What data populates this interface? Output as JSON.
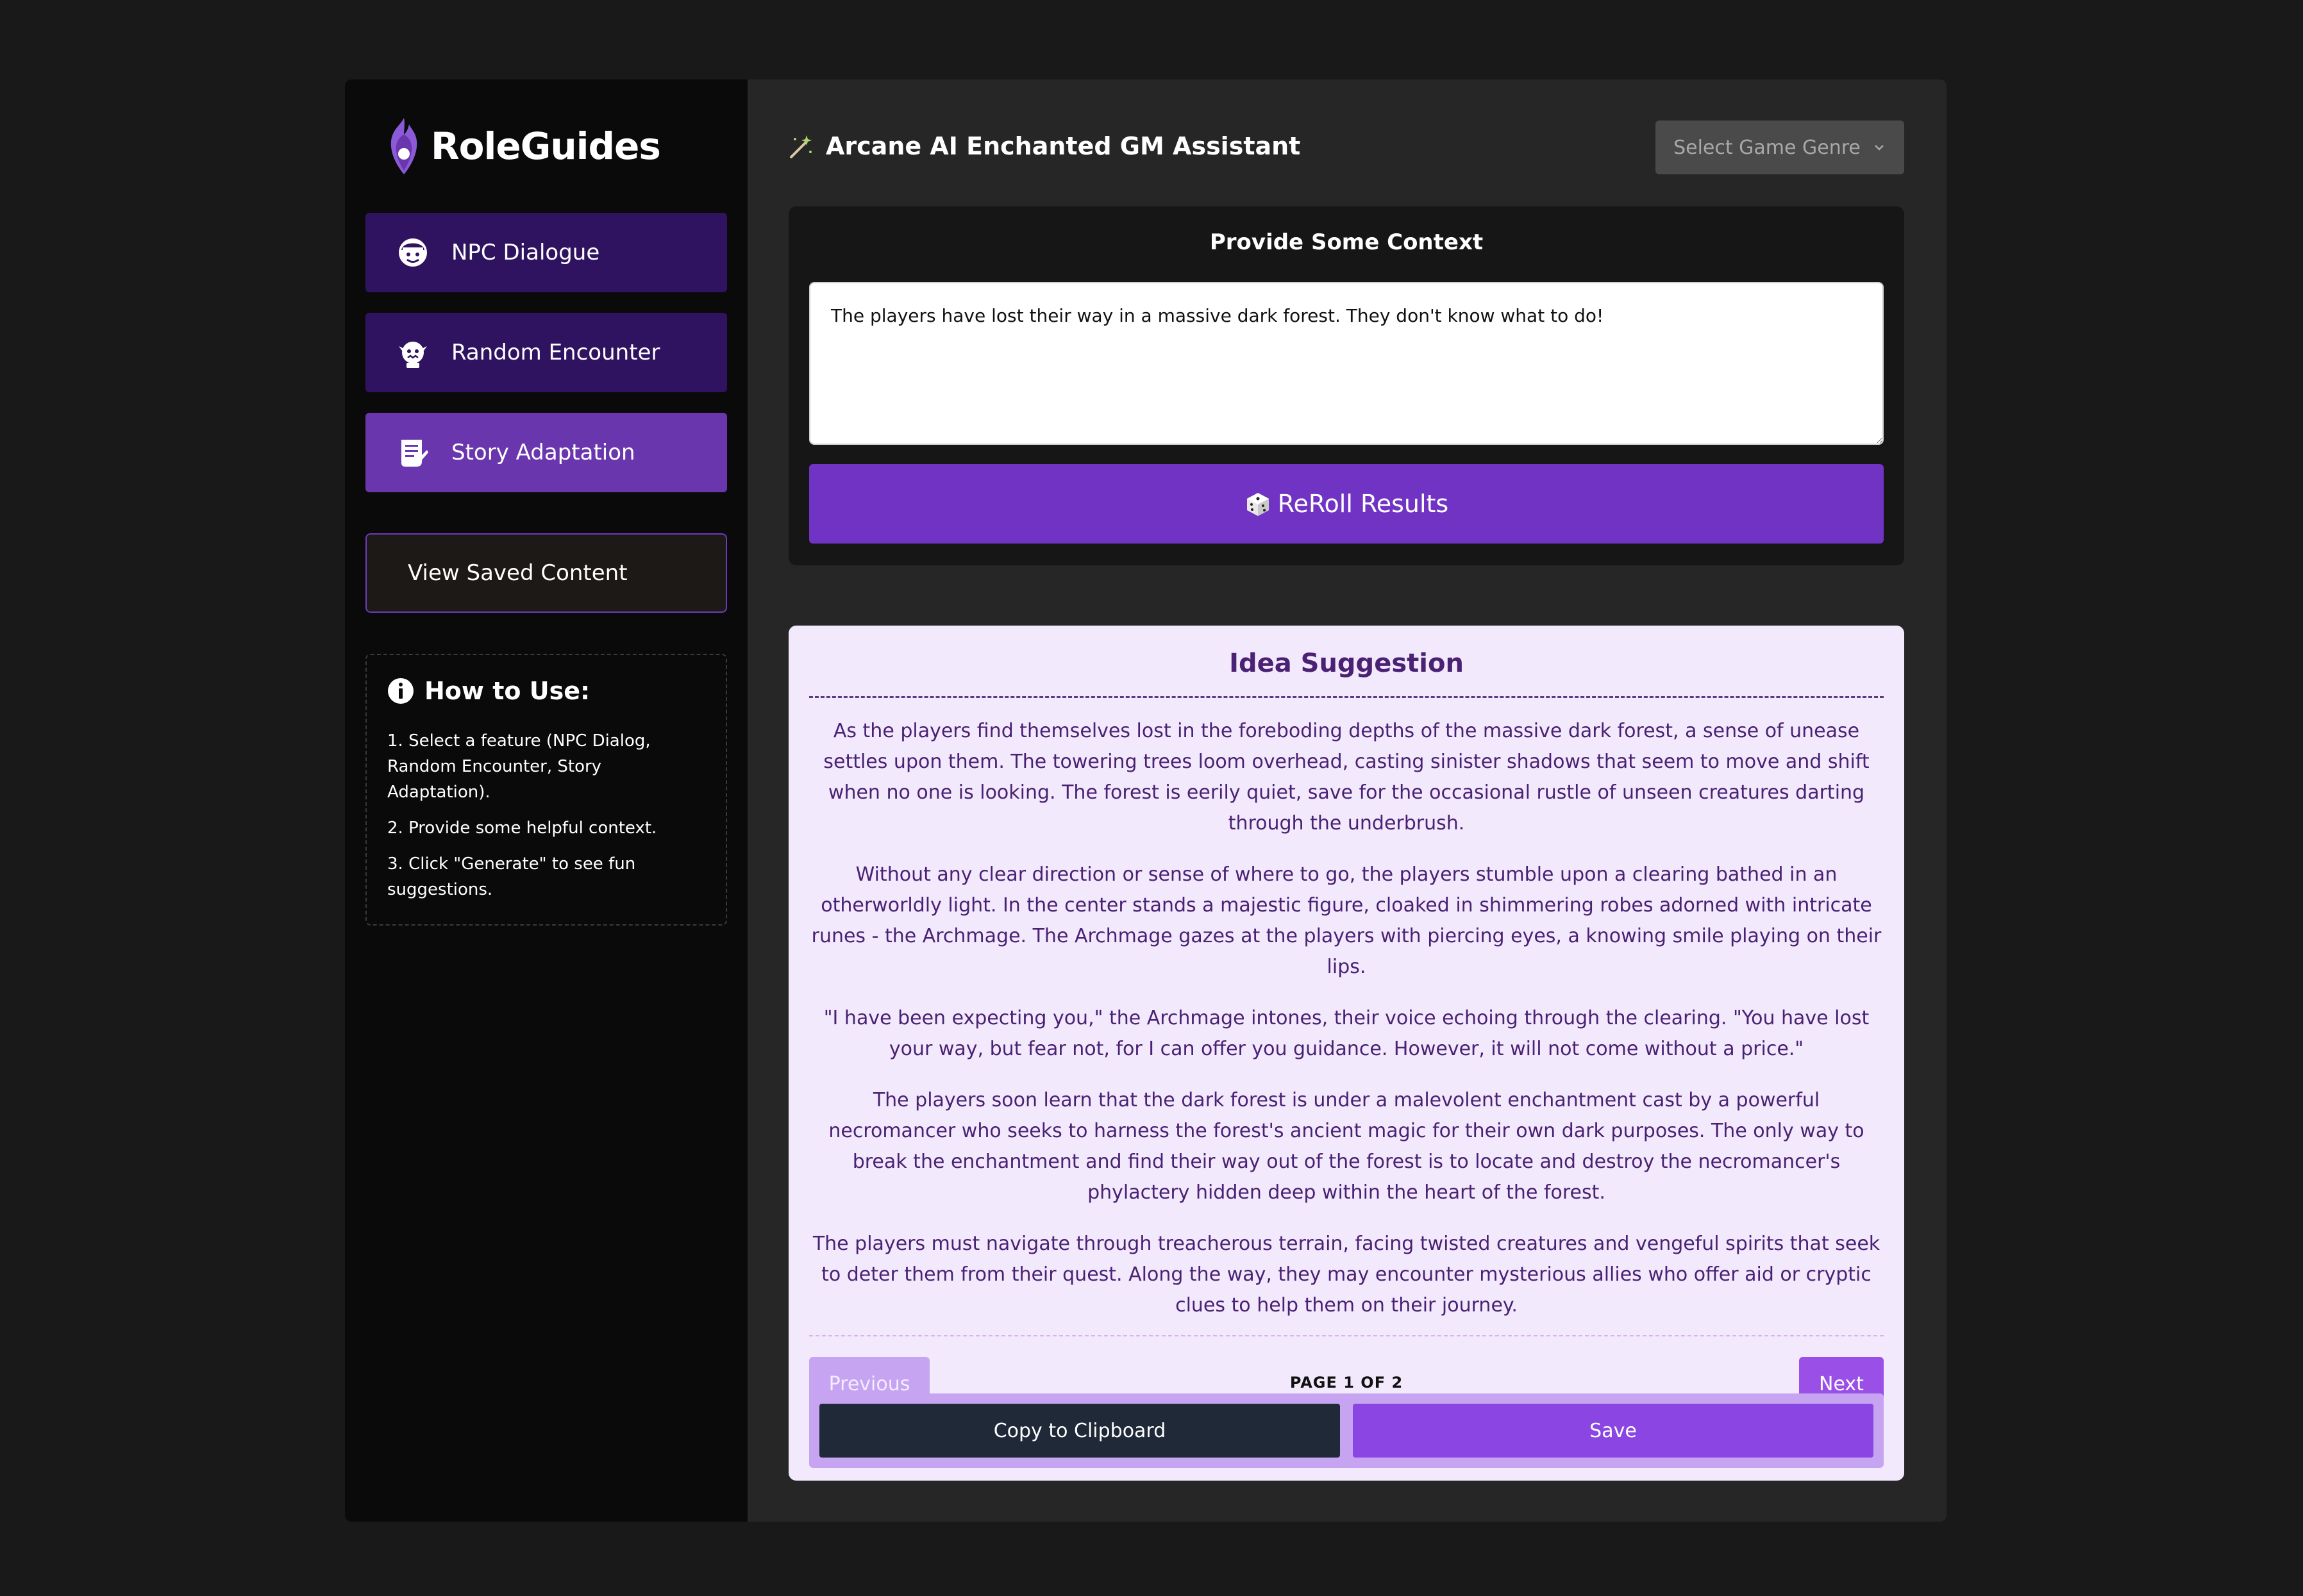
{
  "app": {
    "logo_text": "RoleGuides"
  },
  "sidebar": {
    "items": [
      {
        "label": "NPC Dialogue",
        "icon": "npc-face-icon"
      },
      {
        "label": "Random Encounter",
        "icon": "goblin-icon"
      },
      {
        "label": "Story Adaptation",
        "icon": "scroll-icon"
      }
    ],
    "saved_label": "View Saved Content",
    "howto": {
      "title": "How to Use:",
      "steps": [
        "1. Select a feature (NPC Dialog, Random Encounter, Story Adaptation).",
        "2. Provide some helpful context.",
        "3. Click \"Generate\" to see fun suggestions."
      ]
    }
  },
  "header": {
    "title": "Arcane AI Enchanted GM Assistant",
    "genre_select": "Select Game Genre"
  },
  "context": {
    "title": "Provide Some Context",
    "value": "The players have lost their way in a massive dark forest. They don't know what to do!",
    "reroll_label": "ReRoll Results"
  },
  "idea": {
    "title": "Idea Suggestion",
    "paragraphs": [
      "As the players find themselves lost in the foreboding depths of the massive dark forest, a sense of unease settles upon them. The towering trees loom overhead, casting sinister shadows that seem to move and shift when no one is looking. The forest is eerily quiet, save for the occasional rustle of unseen creatures darting through the underbrush.",
      "Without any clear direction or sense of where to go, the players stumble upon a clearing bathed in an otherworldly light. In the center stands a majestic figure, cloaked in shimmering robes adorned with intricate runes - the Archmage. The Archmage gazes at the players with piercing eyes, a knowing smile playing on their lips.",
      "\"I have been expecting you,\" the Archmage intones, their voice echoing through the clearing. \"You have lost your way, but fear not, for I can offer you guidance. However, it will not come without a price.\"",
      "The players soon learn that the dark forest is under a malevolent enchantment cast by a powerful necromancer who seeks to harness the forest's ancient magic for their own dark purposes. The only way to break the enchantment and find their way out of the forest is to locate and destroy the necromancer's phylactery hidden deep within the heart of the forest.",
      "The players must navigate through treacherous terrain, facing twisted creatures and vengeful spirits that seek to deter them from their quest. Along the way, they may encounter mysterious allies who offer aid or cryptic clues to help them on their journey."
    ],
    "prev_label": "Previous",
    "next_label": "Next",
    "page_label": "PAGE 1 OF 2",
    "copy_label": "Copy to Clipboard",
    "save_label": "Save"
  },
  "colors": {
    "accent": "#7133c4",
    "nav_active": "#6a36ae",
    "nav_idle": "#2f1360",
    "idea_bg": "#f2e9fc"
  }
}
